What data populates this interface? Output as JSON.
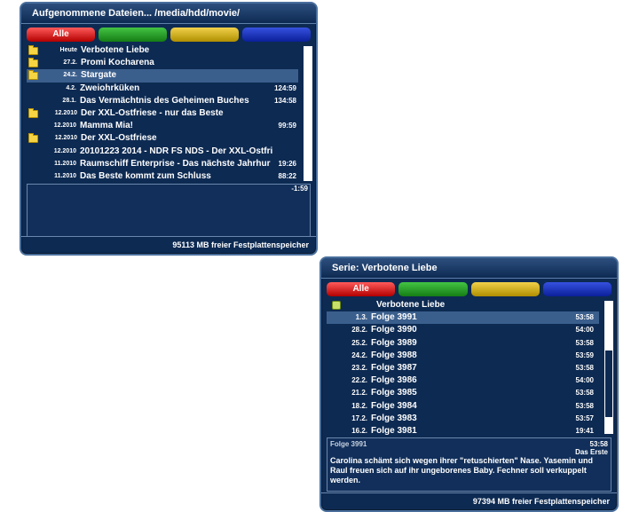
{
  "panel1": {
    "title": "Aufgenommene Dateien...  /media/hdd/movie/",
    "buttons": {
      "red": "Alle",
      "green": "",
      "yellow": "",
      "blue": ""
    },
    "rows": [
      {
        "folder": true,
        "date": "Heute",
        "name": "Verbotene Liebe",
        "dur": ""
      },
      {
        "folder": true,
        "date": "27.2.",
        "name": "Promi Kocharena",
        "dur": ""
      },
      {
        "folder": true,
        "date": "24.2.",
        "name": "Stargate",
        "dur": "",
        "selected": true
      },
      {
        "folder": false,
        "date": "4.2.",
        "name": "Zweiohrküken",
        "dur": "124:59"
      },
      {
        "folder": false,
        "date": "28.1.",
        "name": "Das Vermächtnis des Geheimen Buches",
        "dur": "134:58"
      },
      {
        "folder": true,
        "date": "12.2010",
        "name": "Der XXL-Ostfriese - nur das Beste",
        "dur": ""
      },
      {
        "folder": false,
        "date": "12.2010",
        "name": "Mamma Mia!",
        "dur": "99:59"
      },
      {
        "folder": true,
        "date": "12.2010",
        "name": "Der XXL-Ostfriese",
        "dur": ""
      },
      {
        "folder": false,
        "date": "12.2010",
        "name": "20101223 2014 - NDR FS NDS - Der XXL-Ostfri",
        "dur": ""
      },
      {
        "folder": false,
        "date": "11.2010",
        "name": "Raumschiff Enterprise - Das nächste Jahrhur",
        "dur": "19:26"
      },
      {
        "folder": false,
        "date": "11.2010",
        "name": "Das Beste kommt zum Schluss",
        "dur": "88:22"
      }
    ],
    "info_time": "-1:59",
    "footer": "95113 MB freier Festplattenspeicher"
  },
  "panel2": {
    "title": "Serie: Verbotene Liebe",
    "buttons": {
      "red": "Alle",
      "green": "",
      "yellow": "",
      "blue": ""
    },
    "header_row": "Verbotene Liebe",
    "rows": [
      {
        "date": "1.3.",
        "name": "Folge 3991",
        "dur": "53:58",
        "selected": true
      },
      {
        "date": "28.2.",
        "name": "Folge 3990",
        "dur": "54:00"
      },
      {
        "date": "25.2.",
        "name": "Folge 3989",
        "dur": "53:58"
      },
      {
        "date": "24.2.",
        "name": "Folge 3988",
        "dur": "53:59"
      },
      {
        "date": "23.2.",
        "name": "Folge 3987",
        "dur": "53:58"
      },
      {
        "date": "22.2.",
        "name": "Folge 3986",
        "dur": "54:00"
      },
      {
        "date": "21.2.",
        "name": "Folge 3985",
        "dur": "53:58"
      },
      {
        "date": "18.2.",
        "name": "Folge 3984",
        "dur": "53:58"
      },
      {
        "date": "17.2.",
        "name": "Folge 3983",
        "dur": "53:57"
      },
      {
        "date": "16.2.",
        "name": "Folge 3981",
        "dur": "19:41"
      }
    ],
    "info": {
      "title": "Folge 3991",
      "time": "53:58",
      "channel": "Das Erste",
      "description": "Carolina schämt sich wegen ihrer \"retuschierten\" Nase. Yasemin und Raul freuen sich auf ihr ungeborenes Baby. Fechner soll verkuppelt werden."
    },
    "footer": "97394 MB freier Festplattenspeicher"
  }
}
